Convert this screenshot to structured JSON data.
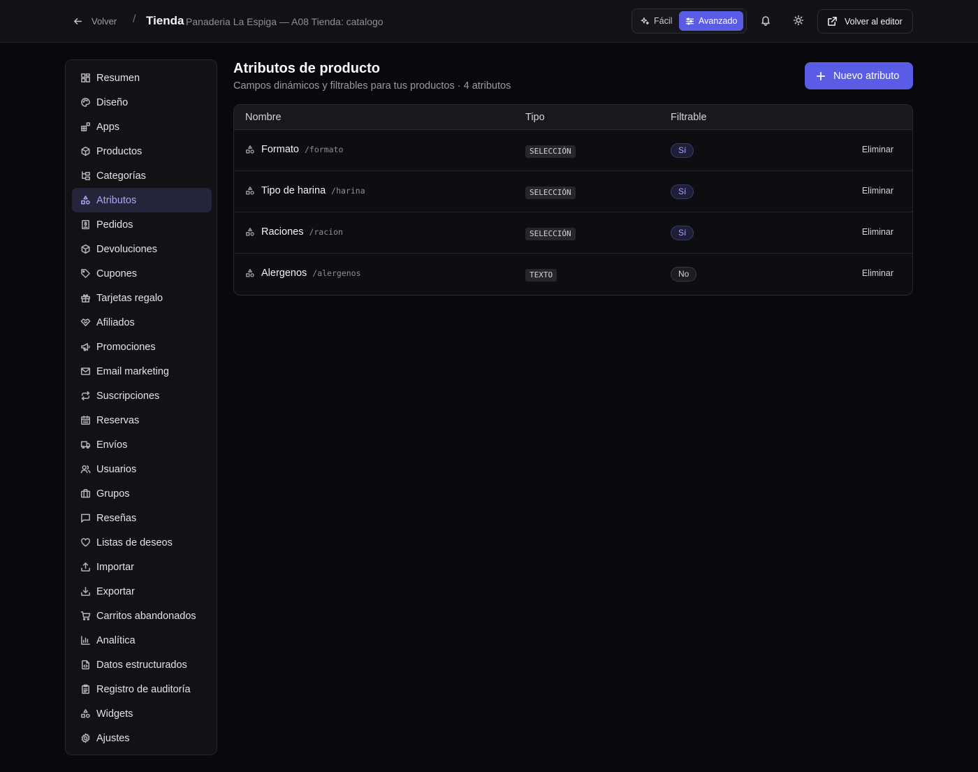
{
  "header": {
    "back_label": "Volver",
    "separator": "/",
    "title": "Tienda",
    "subtitle": "Panaderia La Espiga — A08 Tienda: catalogo",
    "mode_easy": "Fácil",
    "mode_advanced": "Avanzado",
    "mode_selected": "Avanzado",
    "editor_label": "Volver al editor"
  },
  "sidebar": {
    "active": "Atributos",
    "items": [
      {
        "label": "Resumen",
        "icon": "grid-icon"
      },
      {
        "label": "Diseño",
        "icon": "palette-icon"
      },
      {
        "label": "Apps",
        "icon": "apps-icon"
      },
      {
        "label": "Productos",
        "icon": "package-icon"
      },
      {
        "label": "Categorías",
        "icon": "tree-icon"
      },
      {
        "label": "Atributos",
        "icon": "shapes-icon"
      },
      {
        "label": "Pedidos",
        "icon": "receipt-icon"
      },
      {
        "label": "Devoluciones",
        "icon": "package-icon"
      },
      {
        "label": "Cupones",
        "icon": "tag-icon"
      },
      {
        "label": "Tarjetas regalo",
        "icon": "gift-icon"
      },
      {
        "label": "Afiliados",
        "icon": "handshake-icon"
      },
      {
        "label": "Promociones",
        "icon": "megaphone-icon"
      },
      {
        "label": "Email marketing",
        "icon": "mail-icon"
      },
      {
        "label": "Suscripciones",
        "icon": "repeat-icon"
      },
      {
        "label": "Reservas",
        "icon": "calendar-icon"
      },
      {
        "label": "Envíos",
        "icon": "truck-icon"
      },
      {
        "label": "Usuarios",
        "icon": "users-icon"
      },
      {
        "label": "Grupos",
        "icon": "briefcase-icon"
      },
      {
        "label": "Reseñas",
        "icon": "message-icon"
      },
      {
        "label": "Listas de deseos",
        "icon": "heart-icon"
      },
      {
        "label": "Importar",
        "icon": "upload-icon"
      },
      {
        "label": "Exportar",
        "icon": "download-icon"
      },
      {
        "label": "Carritos abandonados",
        "icon": "cart-icon"
      },
      {
        "label": "Analítica",
        "icon": "bar-chart-icon"
      },
      {
        "label": "Datos estructurados",
        "icon": "file-code-icon"
      },
      {
        "label": "Registro de auditoría",
        "icon": "clipboard-icon"
      },
      {
        "label": "Widgets",
        "icon": "shapes-icon"
      },
      {
        "label": "Ajustes",
        "icon": "gear-icon"
      }
    ]
  },
  "main": {
    "title": "Atributos de producto",
    "subtitle": "Campos dinámicos y filtrables para tus productos · 4 atributos",
    "new_button": "Nuevo atributo",
    "columns": [
      "Nombre",
      "Tipo",
      "Filtrable"
    ],
    "rows": [
      {
        "name": "Formato",
        "slug": "/formato",
        "type": "SELECCIÓN",
        "filterable": "Sí",
        "action": "Eliminar"
      },
      {
        "name": "Tipo de harina",
        "slug": "/harina",
        "type": "SELECCIÓN",
        "filterable": "Sí",
        "action": "Eliminar"
      },
      {
        "name": "Raciones",
        "slug": "/racion",
        "type": "SELECCIÓN",
        "filterable": "Sí",
        "action": "Eliminar"
      },
      {
        "name": "Alergenos",
        "slug": "/alergenos",
        "type": "TEXTO",
        "filterable": "No",
        "action": "Eliminar"
      }
    ]
  },
  "colors": {
    "accent": "#5b5ce6",
    "accent_text": "#a5a8ff",
    "background": "#09090d",
    "panel": "#111116"
  }
}
